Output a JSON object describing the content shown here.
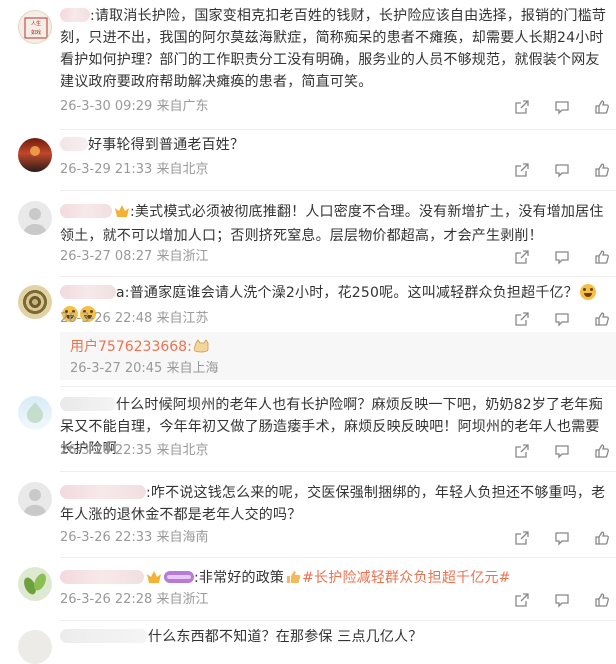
{
  "comments": [
    {
      "text": ":请取消长护险，国家变相克扣老百姓的钱财，长护险应该自由选择，报销的门槛苛刻，只进不出，我国的阿尔莫兹海默症，简称痴呆的患者不瘫痪，却需要人长期24小时看护如何护理？部门的工作职责分工没有明确，服务业的人员不够规范，就假装个网友建议政府要政府帮助解决瘫痪的患者，简直可笑。",
      "meta": "26-3-30 09:29 来自广东"
    },
    {
      "text": "好事轮得到普通老百姓？",
      "meta": "26-3-29 21:33 来自北京"
    },
    {
      "text": ":美式模式必须被彻底推翻！人口密度不合理。没有新增扩土，没有增加居住领土，就不可以增加人口；否则挤死窒息。层层物价都超高，才会产生剥削！",
      "meta": "26-3-27 08:27 来自浙江"
    },
    {
      "text_prefix": "a:",
      "text": "普通家庭谁会请人洗个澡2小时，花250呢。这叫减轻群众负担超千亿？",
      "meta": "26-3-26 22:48 来自江苏",
      "reply": {
        "user": "用户7576233668:",
        "meta": "26-3-27 20:45 来自上海"
      }
    },
    {
      "text": "什么时候阿坝州的老年人也有长护险啊？麻烦反映一下吧，奶奶82岁了老年痴呆又不能自理，今年年初又做了肠造瘘手术，麻烦反映反映吧！阿坝州的老年人也需要长护险啊",
      "meta": "26-3-26 22:35 来自北京"
    },
    {
      "text": ":咋不说这钱怎么来的呢，交医保强制捆绑的，年轻人负担还不够重吗，老年人涨的退休金不都是老年人交的吗？",
      "meta": "26-3-26 22:33 来自海南"
    },
    {
      "text": ":非常好的政策",
      "topic": "#长护险减轻群众负担超千亿元#",
      "meta": "26-3-26 22:28 来自浙江"
    },
    {
      "text": "什么东西都不知道？在那参保 三点几亿人？ ",
      "meta": ""
    }
  ],
  "icons": {
    "share": "share-icon",
    "comment": "comment-icon",
    "like": "like-icon"
  },
  "colors": {
    "link": "#eb7350",
    "meta": "#999999",
    "text": "#333333"
  }
}
